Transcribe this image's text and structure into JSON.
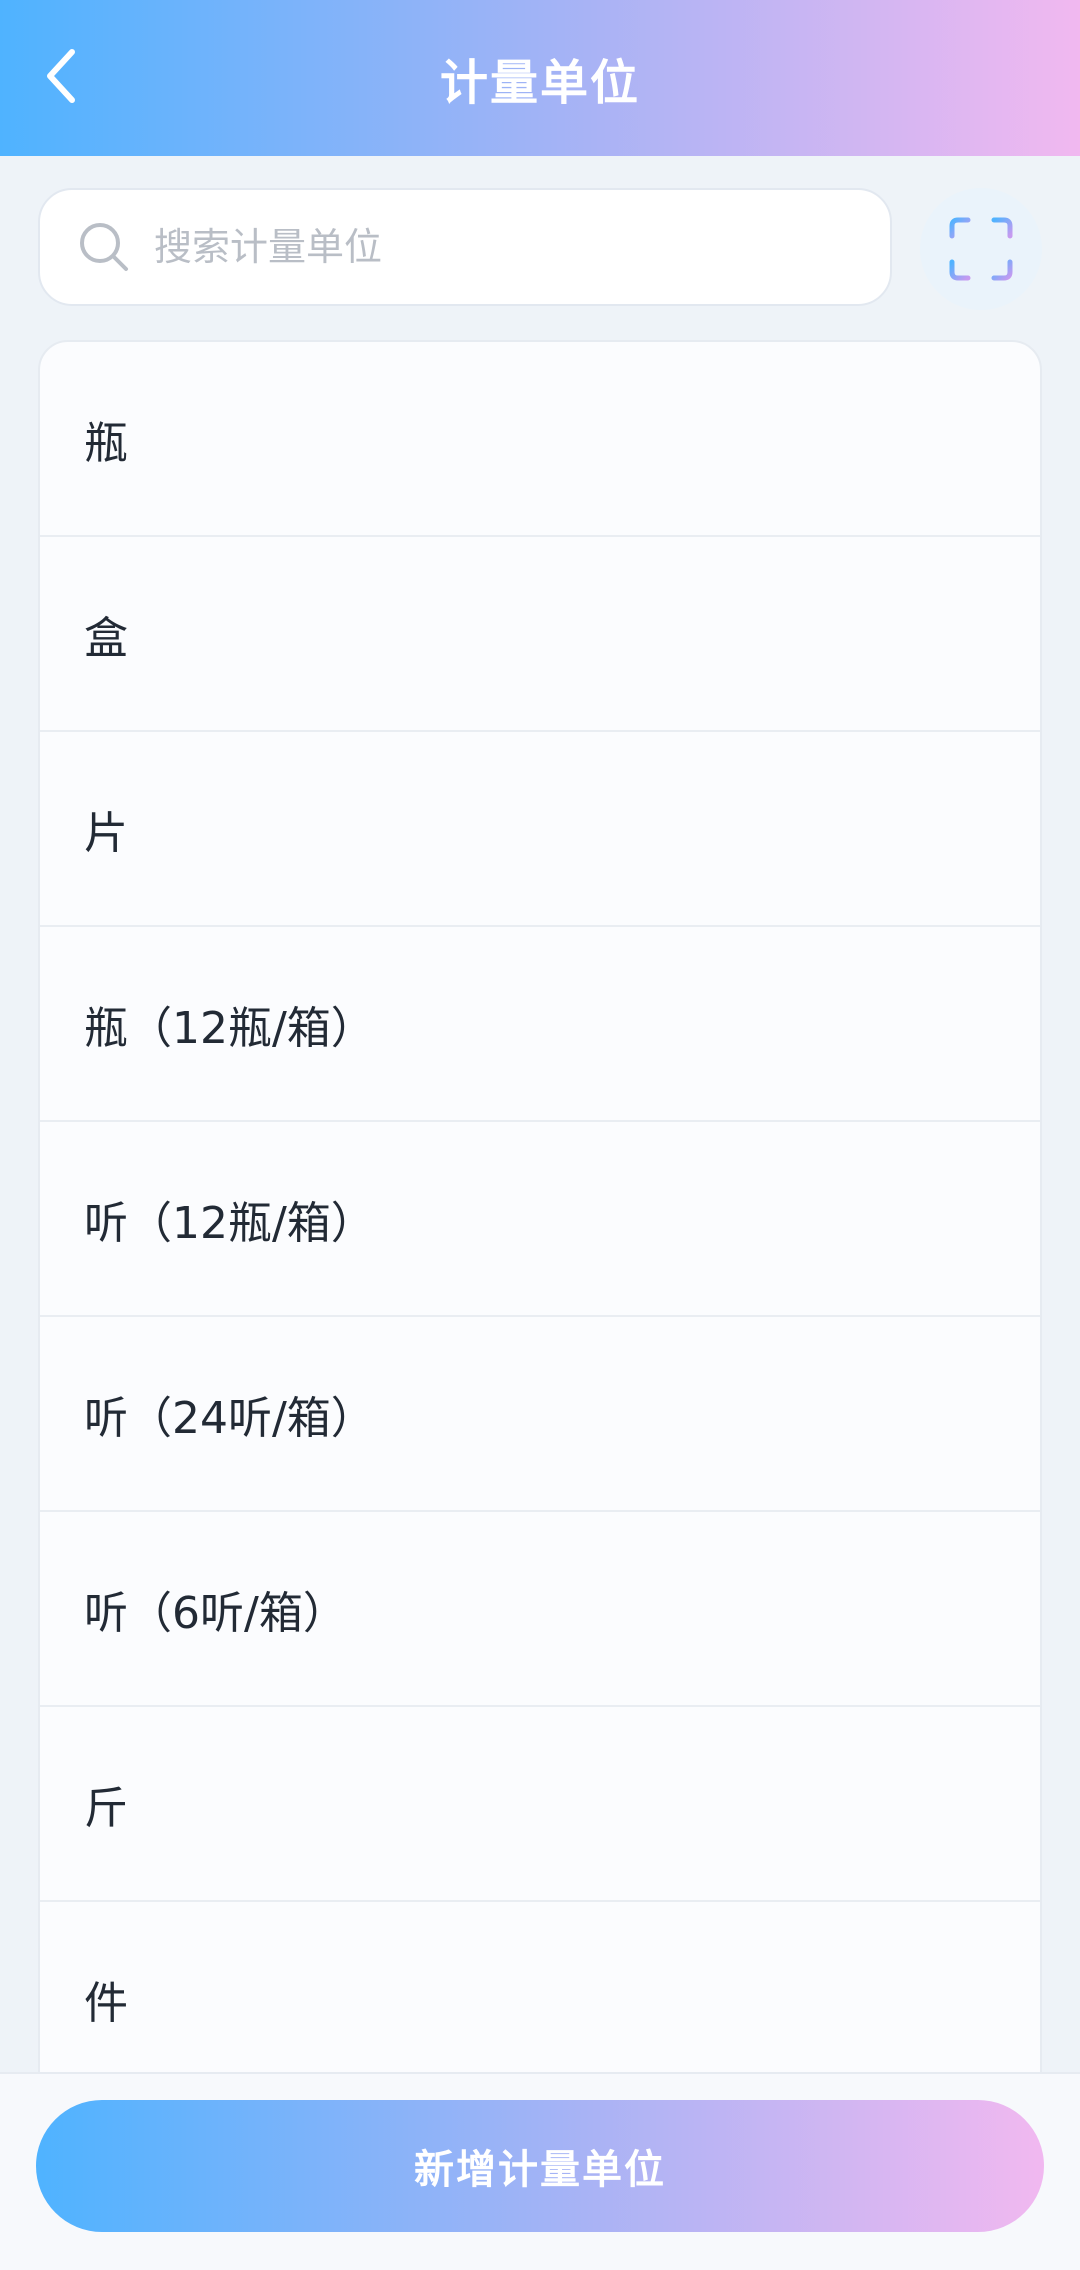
{
  "header": {
    "title": "计量单位",
    "back_icon": "chevron-left-icon"
  },
  "search": {
    "placeholder": "搜索计量单位",
    "value": "",
    "search_icon": "search-icon",
    "scan_icon": "scan-icon"
  },
  "units": {
    "items": [
      {
        "label": "瓶"
      },
      {
        "label": "盒"
      },
      {
        "label": "片"
      },
      {
        "label": "瓶（12瓶/箱）"
      },
      {
        "label": "听（12瓶/箱）"
      },
      {
        "label": "听（24听/箱）"
      },
      {
        "label": "听（6听/箱）"
      },
      {
        "label": "斤"
      },
      {
        "label": "件"
      }
    ]
  },
  "footer": {
    "add_label": "新增计量单位"
  },
  "colors": {
    "gradient_start": "#4fb3ff",
    "gradient_mid": "#a9b3f5",
    "gradient_end": "#f1b8f0",
    "text_primary": "#222a35",
    "placeholder": "#b9bec6"
  }
}
